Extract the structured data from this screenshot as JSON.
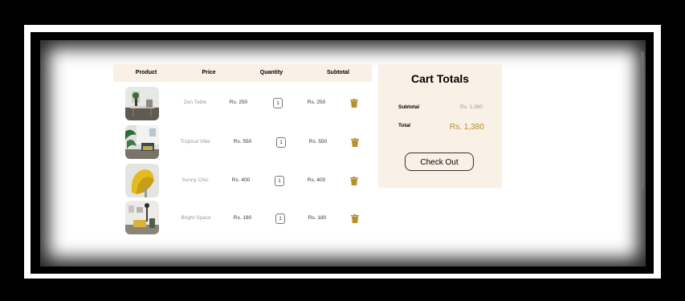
{
  "cart": {
    "headers": {
      "product": "Product",
      "price": "Price",
      "quantity": "Quantity",
      "subtotal": "Subtotal"
    },
    "items": [
      {
        "name": "Zen Table",
        "price": "Rs. 250",
        "qty": "1",
        "subtotal": "Rs. 250",
        "thumb_icon": "zen-table-thumbnail"
      },
      {
        "name": "Tropical Vibe",
        "price": "Rs. 550",
        "qty": "1",
        "subtotal": "Rs. 550",
        "thumb_icon": "tropical-vibe-thumbnail"
      },
      {
        "name": "Sunny Chic",
        "price": "Rs. 400",
        "qty": "1",
        "subtotal": "Rs. 400",
        "thumb_icon": "sunny-chic-thumbnail"
      },
      {
        "name": "Bright Space",
        "price": "Rs. 180",
        "qty": "1",
        "subtotal": "Rs. 180",
        "thumb_icon": "bright-space-thumbnail"
      }
    ]
  },
  "totals": {
    "title": "Cart Totals",
    "subtotal_label": "Subtotal",
    "subtotal_value": "Rs. 1,380",
    "total_label": "Total",
    "total_value": "Rs. 1,380",
    "checkout_label": "Check Out"
  },
  "colors": {
    "panel_bg": "#f9f0e6",
    "accent": "#b88e2f"
  }
}
